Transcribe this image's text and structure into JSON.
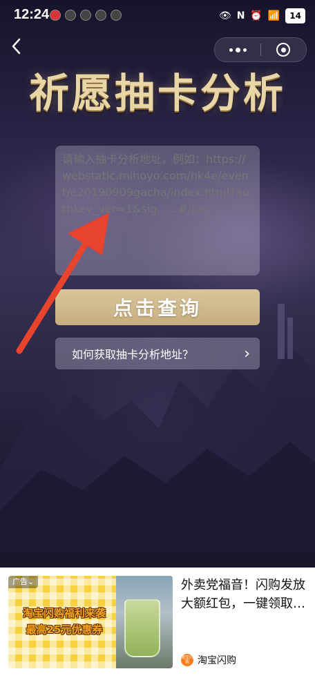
{
  "status_bar": {
    "time": "12:24",
    "battery": "14"
  },
  "header": {
    "back_icon": "chevron-left-icon",
    "more_icon": "more-dots-icon",
    "target_icon": "close-target-icon"
  },
  "page": {
    "title": "祈愿抽卡分析",
    "url_placeholder": "请输入抽卡分析地址，例如：https://webstatic.mihoyo.com/hk4e/event/e20190909gacha/index.html?authkey_ver=1&sig......#/log",
    "query_button": "点击查询",
    "howto_label": "如何获取抽卡分析地址？",
    "howto_chevron": "›"
  },
  "ad": {
    "tag": "广告⌄",
    "banner_line1": "淘宝闪购福利来袭",
    "banner_line2": "最高25元优惠券",
    "title": "外卖党福音！闪购发放大额红包，一键领取…",
    "brand": "淘宝闪购",
    "brand_logo_text": "淘宝闪购"
  },
  "colors": {
    "accent_gold": "#d4bd8f",
    "arrow_red": "#e8432d"
  }
}
